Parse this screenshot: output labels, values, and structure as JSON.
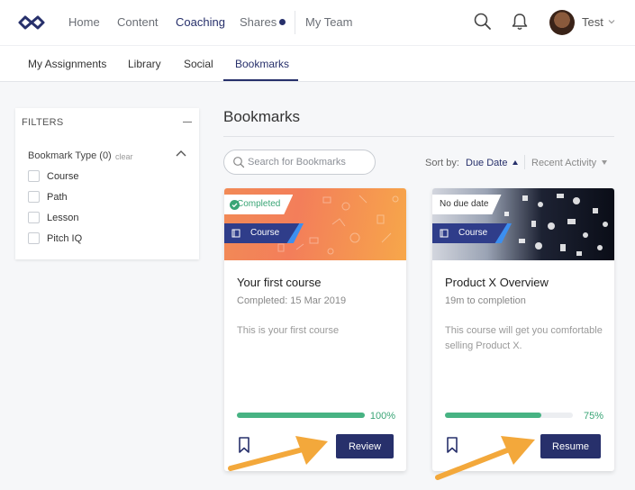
{
  "nav": {
    "items": [
      "Home",
      "Content",
      "Coaching",
      "Shares",
      "My Team"
    ],
    "active": "Coaching",
    "user_name": "Test"
  },
  "subnav": {
    "tabs": [
      "My Assignments",
      "Library",
      "Social",
      "Bookmarks"
    ],
    "active": "Bookmarks"
  },
  "filters": {
    "title": "FILTERS",
    "group_label": "Bookmark Type (0)",
    "clear_label": "clear",
    "options": [
      "Course",
      "Path",
      "Lesson",
      "Pitch IQ"
    ]
  },
  "main": {
    "title": "Bookmarks",
    "search_placeholder": "Search for Bookmarks",
    "sort_label": "Sort by:",
    "sort_active": "Due Date",
    "sort_other": "Recent Activity"
  },
  "cards": [
    {
      "status": "Completed",
      "type": "Course",
      "title": "Your first course",
      "subtitle": "Completed: 15 Mar 2019",
      "description": "This is your first course",
      "progress": 100,
      "progress_label": "100%",
      "button": "Review"
    },
    {
      "status": "No due date",
      "type": "Course",
      "title": "Product X Overview",
      "subtitle": "19m to completion",
      "description": "This course will get you comfortable selling Product X.",
      "progress": 75,
      "progress_label": "75%",
      "button": "Resume"
    }
  ],
  "colors": {
    "primary": "#27306b",
    "progress": "#47b383",
    "accent_arrow": "#f3a83b"
  }
}
